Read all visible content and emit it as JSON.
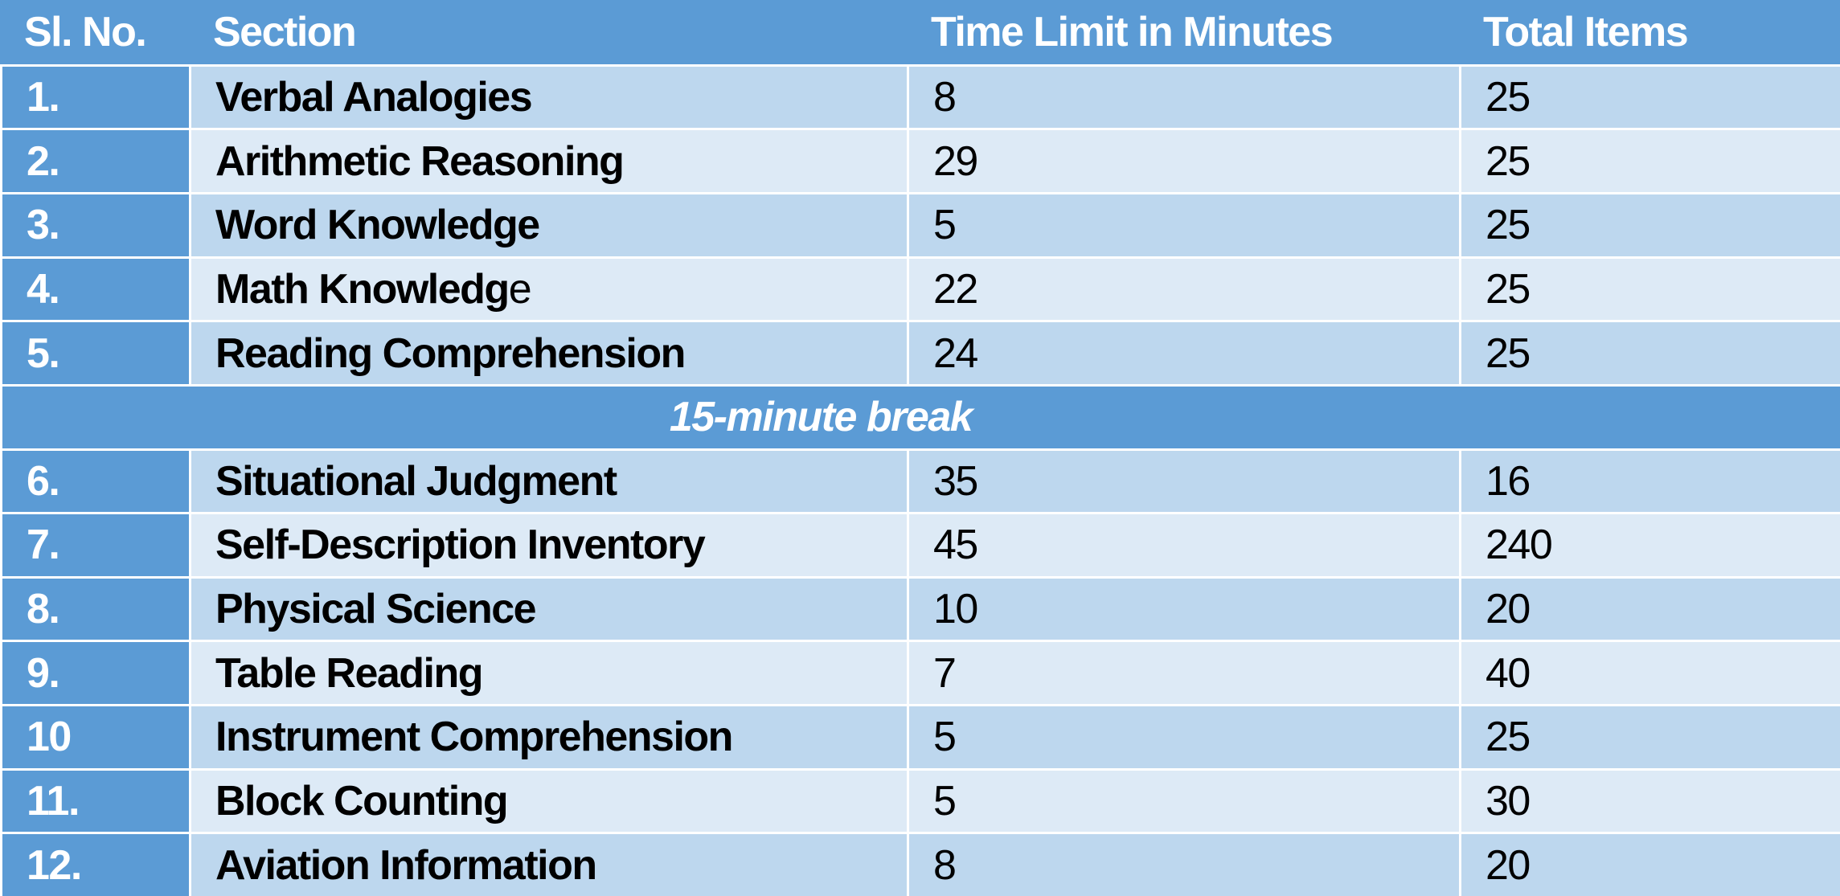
{
  "colors": {
    "header_bg": "#5b9bd5",
    "row_dark": "#bdd7ee",
    "row_light": "#ddeaf6",
    "header_text": "#ffffff",
    "body_text": "#000000"
  },
  "table": {
    "headers": [
      "Sl. No.",
      "Section",
      "Time Limit in Minutes",
      "Total Items"
    ],
    "rows_before_break": [
      {
        "sl": "1.",
        "section": "Verbal Analogies",
        "time": "8",
        "items": "25"
      },
      {
        "sl": "2.",
        "section": "Arithmetic Reasoning",
        "time": "29",
        "items": "25"
      },
      {
        "sl": "3.",
        "section": "Word Knowledge",
        "time": "5",
        "items": "25"
      },
      {
        "sl": "4.",
        "section": "Math Knowledg",
        "section_tail": "e",
        "time": "22",
        "items": "25"
      },
      {
        "sl": "5.",
        "section": "Reading Comprehension",
        "time": "24",
        "items": "25"
      }
    ],
    "break_label": "15-minute break",
    "rows_after_break": [
      {
        "sl": "6.",
        "section": "Situational Judgment",
        "time": "35",
        "items": "16"
      },
      {
        "sl": "7.",
        "section": "Self-Description Inventory",
        "time": "45",
        "items": "240"
      },
      {
        "sl": "8.",
        "section": "Physical Science",
        "time": "10",
        "items": "20"
      },
      {
        "sl": "9.",
        "section": "Table Reading",
        "time": "7",
        "items": "40"
      },
      {
        "sl": "10",
        "section": "Instrument Comprehension",
        "time": "5",
        "items": "25"
      },
      {
        "sl": "11.",
        "section": "Block Counting",
        "time": "5",
        "items": "30"
      },
      {
        "sl": "12.",
        "section": "Aviation Information",
        "time": "8",
        "items": "20"
      }
    ]
  }
}
